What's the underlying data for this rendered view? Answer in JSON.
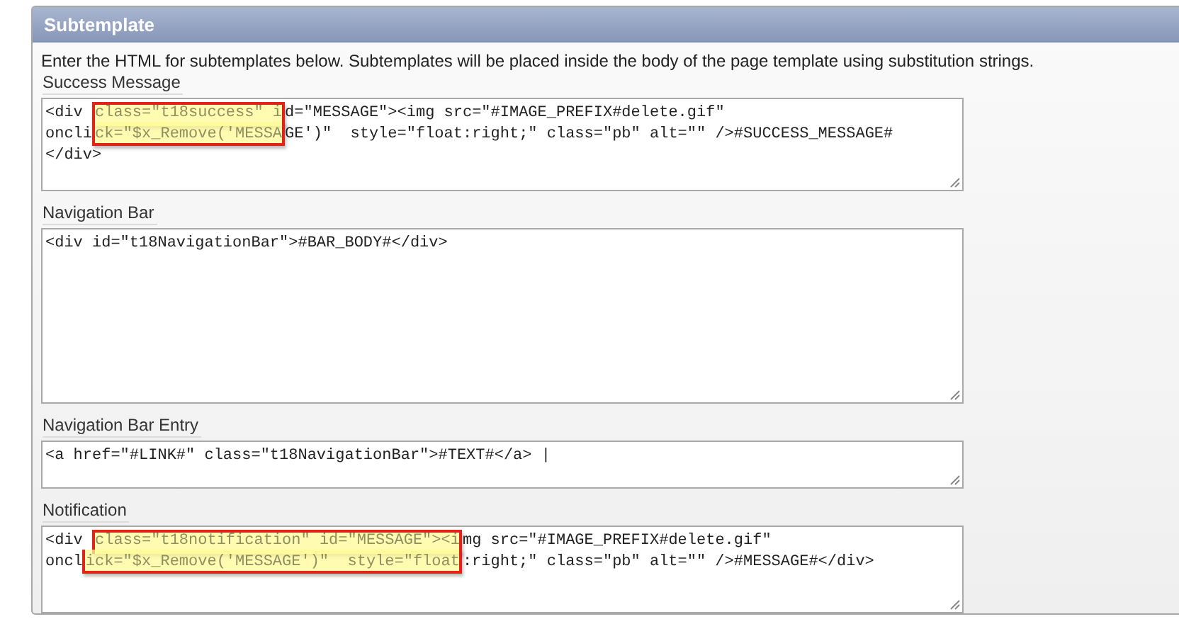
{
  "panel": {
    "title": "Subtemplate",
    "intro": "Enter the HTML for subtemplates below. Subtemplates will be placed inside the body of the page template using substitution strings.",
    "fields": [
      {
        "label": "Success Message",
        "lines": [
          [
            {
              "text": "<div ",
              "marked": false
            },
            {
              "text": "class=\"t18success\" i",
              "marked": true
            },
            {
              "text": "d=\"MESSAGE\"><img src=\"#IMAGE_PREFIX#delete.gif\"",
              "marked": false
            }
          ],
          [
            {
              "text": "oncli",
              "marked": false
            },
            {
              "text": "ck=\"$x_Remove('MESSA",
              "marked": true
            },
            {
              "text": "GE')\"  style=\"float:right;\" class=\"pb\" alt=\"\" />#SUCCESS_MESSAGE#",
              "marked": false
            }
          ],
          [
            {
              "text": "</div>",
              "marked": false
            }
          ]
        ]
      },
      {
        "label": "Navigation Bar",
        "lines": [
          [
            {
              "text": "<div id=\"t18NavigationBar\">#BAR_BODY#</div>",
              "marked": false
            }
          ]
        ]
      },
      {
        "label": "Navigation Bar Entry",
        "lines": [
          [
            {
              "text": "<a href=\"#LINK#\" class=\"t18NavigationBar\">#TEXT#</a> |",
              "marked": false
            }
          ]
        ]
      },
      {
        "label": "Notification",
        "lines": [
          [
            {
              "text": "<div ",
              "marked": false
            },
            {
              "text": "class=\"t18notification\" id=\"MESSAGE\"><i",
              "marked": true
            },
            {
              "text": "mg src=\"#IMAGE_PREFIX#delete.gif\"",
              "marked": false
            }
          ],
          [
            {
              "text": "oncl",
              "marked": false
            },
            {
              "text": "ick=\"$x_Remove('MESSAGE')\"  style=\"float",
              "marked": true
            },
            {
              "text": ":right;\" class=\"pb\" alt=\"\" />#MESSAGE#</div>",
              "marked": false
            }
          ]
        ]
      }
    ]
  }
}
